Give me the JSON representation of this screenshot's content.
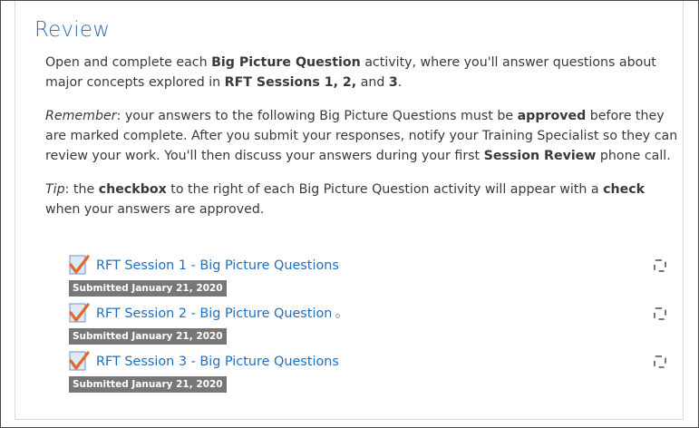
{
  "section": {
    "title": "Review"
  },
  "summary": {
    "p1_a": "Open and complete each ",
    "p1_b": "Big Picture Question",
    "p1_c": " activity, where you'll answer questions about major concepts explored in ",
    "p1_d": "RFT Sessions 1, 2,",
    "p1_e": " and ",
    "p1_f": "3",
    "p1_g": ".",
    "p2_a": "Remember",
    "p2_b": ": your answers to the following Big Picture Questions must be ",
    "p2_c": "approved",
    "p2_d": " before they are marked complete. After you submit your responses, notify your Training Specialist so they can review your work. You'll then discuss your answers during your first ",
    "p2_e": "Session Review",
    "p2_f": " phone call.",
    "p3_a": "Tip",
    "p3_b": ": the ",
    "p3_c": "checkbox",
    "p3_d": " to the right of each Big Picture Question activity will appear with a ",
    "p3_e": "check",
    "p3_f": " when your answers are approved."
  },
  "activities": [
    {
      "name": "RFT Session 1 - Big Picture Questions",
      "status": "Submitted January 21, 2020",
      "icon": "assignment-check-icon"
    },
    {
      "name": "RFT Session 2 - Big Picture Question",
      "status": "Submitted January 21, 2020",
      "icon": "assignment-check-icon"
    },
    {
      "name": "RFT Session 3 - Big Picture Questions",
      "status": "Submitted January 21, 2020",
      "icon": "assignment-check-icon"
    }
  ],
  "colors": {
    "title": "#2a6ebb",
    "link": "#1f6fbf",
    "badge": "#777777",
    "check": "#e06a2b"
  }
}
